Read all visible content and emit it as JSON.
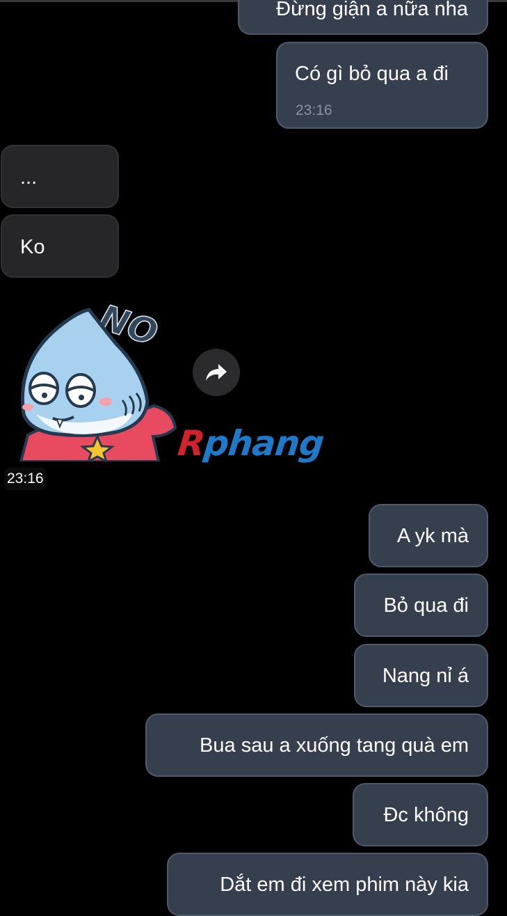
{
  "messages_top": [
    {
      "text": "Đừng giận a nữa nha",
      "from": "me"
    },
    {
      "text": "Có gì bỏ qua a đi",
      "time": "23:16",
      "from": "me"
    }
  ],
  "received": [
    {
      "text": "..."
    },
    {
      "text": "Ko"
    }
  ],
  "sticker": {
    "caption": "NO",
    "icon": "shark-no-sticker",
    "time": "23:16"
  },
  "forward_icon": "forward-arrow-icon",
  "watermark": {
    "first_letter": "R",
    "rest": "phang"
  },
  "messages_bottom": [
    {
      "text": "A yk mà"
    },
    {
      "text": "Bỏ qua đi"
    },
    {
      "text": "Nang nỉ á"
    },
    {
      "text": "Bua sau a xuống tang quà em"
    },
    {
      "text": "Đc không"
    },
    {
      "text": "Dắt em đi xem phim này kia"
    }
  ],
  "colors": {
    "background": "#000000",
    "sent_bubble": "#363f4d",
    "received_bubble": "#262628",
    "timestamp": "#8b93a0"
  }
}
